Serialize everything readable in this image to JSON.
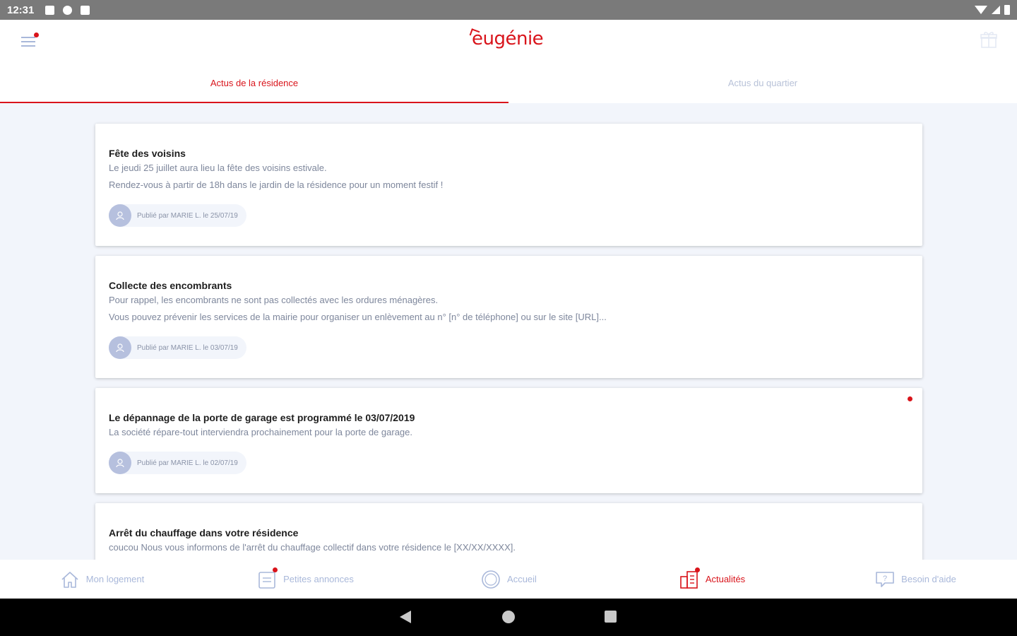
{
  "status_bar": {
    "time": "12:31"
  },
  "app": {
    "logo_text": "eugénie",
    "brand_color": "#d9141b",
    "accent_muted": "#a9b8da"
  },
  "tabs": [
    {
      "label": "Actus de la résidence",
      "active": true
    },
    {
      "label": "Actus du quartier",
      "active": false
    }
  ],
  "posts": [
    {
      "title": "Fête des voisins",
      "lines": [
        "Le jeudi 25 juillet aura lieu la fête des voisins estivale.",
        "Rendez-vous à partir de 18h dans le jardin de la résidence pour un moment festif !"
      ],
      "author": "Publié par MARIE L. le 25/07/19",
      "unread": false
    },
    {
      "title": "Collecte des encombrants",
      "lines": [
        "Pour rappel,  les encombrants ne sont pas collectés avec les ordures ménagères.",
        "Vous pouvez prévenir les services de la mairie  pour organiser un enlèvement  au n°  [n° de  téléphone] ou sur le site [URL]..."
      ],
      "author": "Publié par MARIE L. le 03/07/19",
      "unread": false
    },
    {
      "title": "Le dépannage de la porte de garage est programmé le 03/07/2019",
      "lines": [
        "La société répare-tout interviendra prochainement pour la porte de garage."
      ],
      "author": "Publié par MARIE L. le 02/07/19",
      "unread": true
    },
    {
      "title": "Arrêt du chauffage dans votre résidence",
      "lines": [
        "coucou Nous vous informons de l'arrêt du chauffage collectif dans votre résidence le [XX/XX/XXXX]."
      ],
      "author": "",
      "unread": false
    }
  ],
  "bottom_nav": [
    {
      "label": "Mon logement",
      "icon": "house-icon",
      "active": false,
      "badge": false
    },
    {
      "label": "Petites annonces",
      "icon": "notepad-icon",
      "active": false,
      "badge": true
    },
    {
      "label": "Accueil",
      "icon": "circle-home-icon",
      "active": false,
      "badge": false
    },
    {
      "label": "Actualités",
      "icon": "buildings-icon",
      "active": true,
      "badge": true
    },
    {
      "label": "Besoin d'aide",
      "icon": "help-chat-icon",
      "active": false,
      "badge": false
    }
  ]
}
